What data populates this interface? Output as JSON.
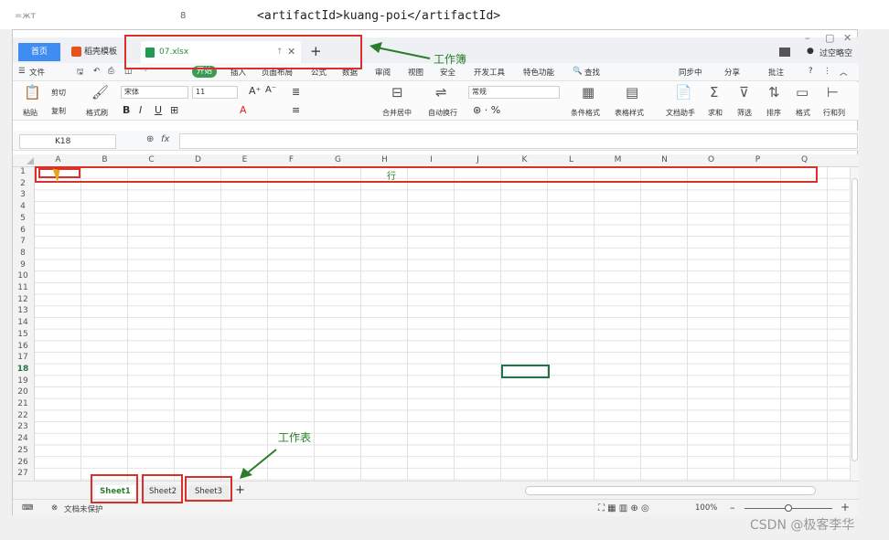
{
  "editor": {
    "line_left": "=жт",
    "line_num": "8",
    "code": "<artifactId>kuang-poi</artifactId>"
  },
  "tabs": {
    "home": "首页",
    "template": "稻壳模板",
    "file": "07.xlsx",
    "add": "+",
    "user": "过空略空"
  },
  "menu": {
    "file": "文件",
    "start": "开始",
    "insert": "插入",
    "layout": "页面布局",
    "formula": "公式",
    "data": "数据",
    "review": "审阅",
    "view": "视图",
    "security": "安全",
    "dev": "开发工具",
    "special": "特色功能",
    "search": "查找",
    "sync": "同步中",
    "share": "分享",
    "comment": "批注"
  },
  "ribbon": {
    "paste": "粘贴",
    "cut": "剪切",
    "copy": "复制",
    "format_painter": "格式刷",
    "font": "宋体",
    "size": "11",
    "merge": "合并居中",
    "wrap": "自动换行",
    "numfmt": "常规",
    "cond": "条件格式",
    "tablestyle": "表格样式",
    "doc": "文档助手",
    "sum": "求和",
    "filter": "筛选",
    "sort": "排序",
    "fmt": "格式",
    "rowcol": "行和列"
  },
  "formula": {
    "cell": "K18",
    "fx": "fx"
  },
  "columns": [
    "A",
    "B",
    "C",
    "D",
    "E",
    "F",
    "G",
    "H",
    "I",
    "J",
    "K",
    "L",
    "M",
    "N",
    "O",
    "P",
    "Q"
  ],
  "rows": [
    "1",
    "2",
    "3",
    "4",
    "5",
    "6",
    "7",
    "8",
    "9",
    "10",
    "11",
    "12",
    "13",
    "14",
    "15",
    "16",
    "17",
    "18",
    "19",
    "20",
    "21",
    "22",
    "23",
    "24",
    "25",
    "26",
    "27"
  ],
  "sheets": [
    "Sheet1",
    "Sheet2",
    "Sheet3"
  ],
  "status": {
    "doc_unprotected": "文档未保护",
    "zoom": "100%"
  },
  "annotations": {
    "workbook": "工作簿",
    "row": "行",
    "worksheet": "工作表"
  },
  "watermark": "CSDN @极客李华"
}
